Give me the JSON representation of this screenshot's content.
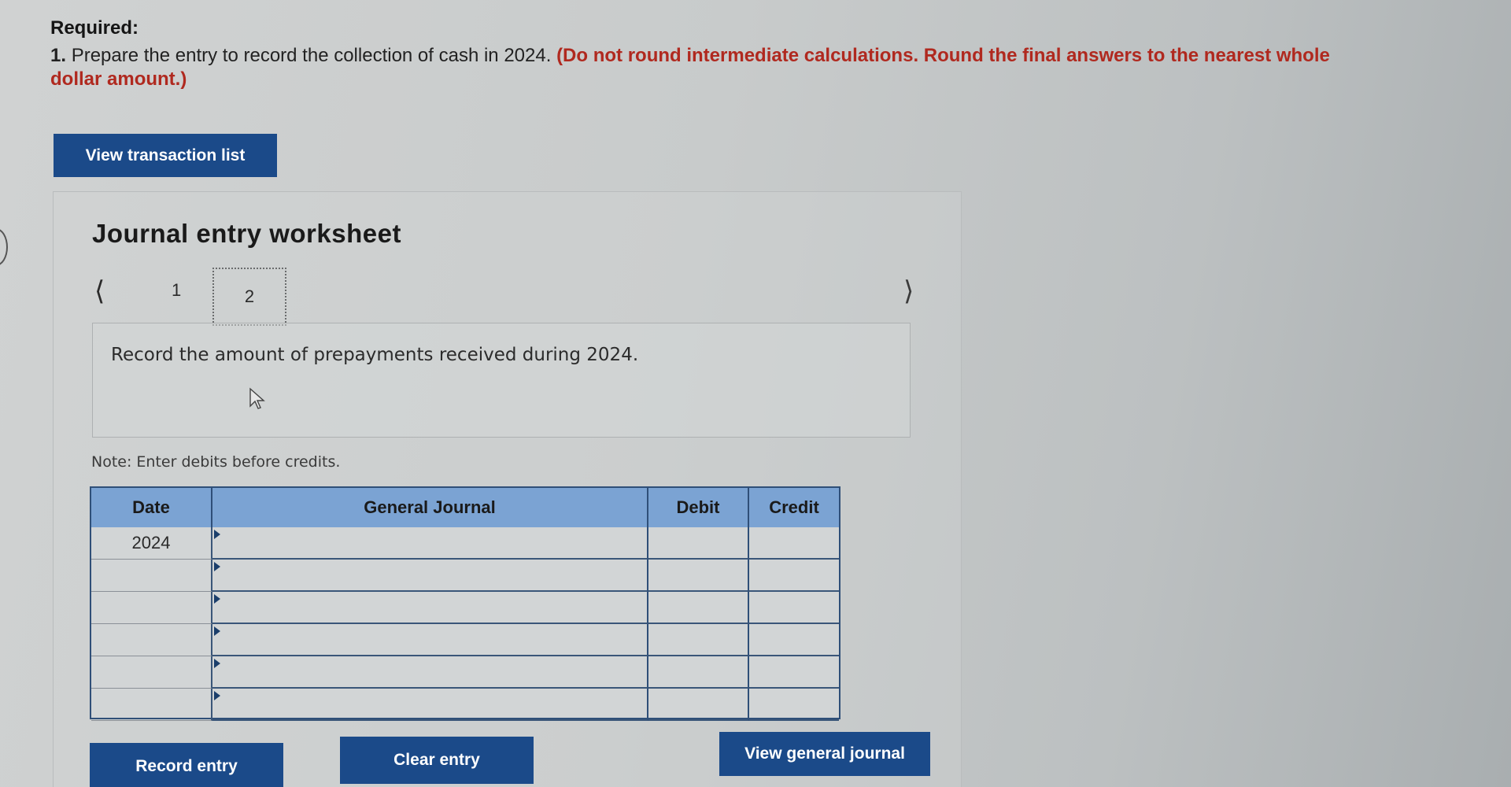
{
  "header": {
    "required_label": "Required:",
    "instruction_number": "1.",
    "instruction_text": "Prepare the entry to record the collection of cash in 2024.",
    "instruction_note": "(Do not round intermediate calculations. Round the final answers to the nearest whole dollar amount.)"
  },
  "buttons": {
    "view_transaction_list": "View transaction list",
    "record_entry": "Record entry",
    "clear_entry": "Clear entry",
    "view_general_journal": "View general journal"
  },
  "worksheet": {
    "title": "Journal entry worksheet",
    "pages": [
      "1",
      "2"
    ],
    "active_page": "2",
    "record_prompt": "Record the amount of prepayments received during 2024.",
    "note": "Note: Enter debits before credits."
  },
  "journal": {
    "columns": [
      "Date",
      "General Journal",
      "Debit",
      "Credit"
    ],
    "rows": [
      {
        "date": "2024",
        "account": "",
        "debit": "",
        "credit": ""
      },
      {
        "date": "",
        "account": "",
        "debit": "",
        "credit": ""
      },
      {
        "date": "",
        "account": "",
        "debit": "",
        "credit": ""
      },
      {
        "date": "",
        "account": "",
        "debit": "",
        "credit": ""
      },
      {
        "date": "",
        "account": "",
        "debit": "",
        "credit": ""
      },
      {
        "date": "",
        "account": "",
        "debit": "",
        "credit": ""
      }
    ]
  },
  "colors": {
    "button_bg": "#1b4a89",
    "header_bg": "#7ba3d3",
    "note_red": "#b0291f"
  }
}
